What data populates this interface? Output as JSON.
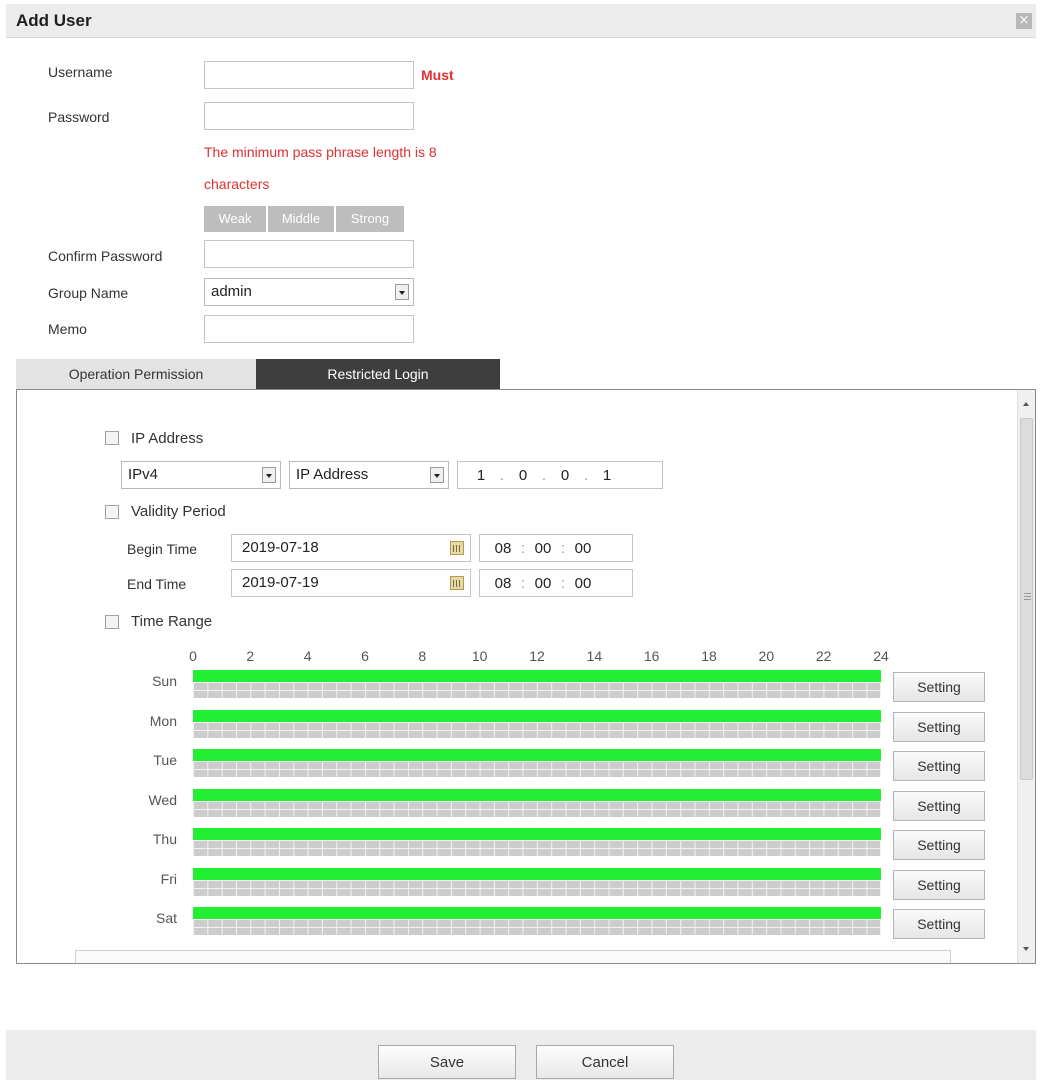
{
  "dialog": {
    "title": "Add User",
    "close_glyph": "×"
  },
  "form": {
    "username": {
      "label": "Username",
      "value": "",
      "required_hint": "Must"
    },
    "password": {
      "label": "Password",
      "value": "",
      "hint_line1": "The minimum pass phrase length is 8",
      "hint_line2": "characters",
      "strength": [
        "Weak",
        "Middle",
        "Strong"
      ]
    },
    "confirm_password": {
      "label": "Confirm Password",
      "value": ""
    },
    "group_name": {
      "label": "Group Name",
      "selected": "admin"
    },
    "memo": {
      "label": "Memo",
      "value": ""
    }
  },
  "tabs": [
    {
      "label": "Operation Permission",
      "active": false
    },
    {
      "label": "Restricted Login",
      "active": true
    }
  ],
  "restricted": {
    "ip_address": {
      "label": "IP Address",
      "checked": false,
      "version": "IPv4",
      "mode": "IP Address",
      "octets": [
        "1",
        "0",
        "0",
        "1"
      ]
    },
    "validity_period": {
      "label": "Validity Period",
      "checked": false,
      "begin": {
        "label": "Begin Time",
        "date": "2019-07-18",
        "hh": "08",
        "mm": "00",
        "ss": "00"
      },
      "end": {
        "label": "End Time",
        "date": "2019-07-19",
        "hh": "08",
        "mm": "00",
        "ss": "00"
      }
    },
    "time_range": {
      "label": "Time Range",
      "checked": false,
      "hours": [
        "0",
        "2",
        "4",
        "6",
        "8",
        "10",
        "12",
        "14",
        "16",
        "18",
        "20",
        "22",
        "24"
      ],
      "days": [
        "Sun",
        "Mon",
        "Tue",
        "Wed",
        "Thu",
        "Fri",
        "Sat"
      ],
      "selected_fraction": 1.0,
      "bar_color": "#22ee33",
      "setting_label": "Setting"
    }
  },
  "footer": {
    "save_label": "Save",
    "cancel_label": "Cancel"
  }
}
